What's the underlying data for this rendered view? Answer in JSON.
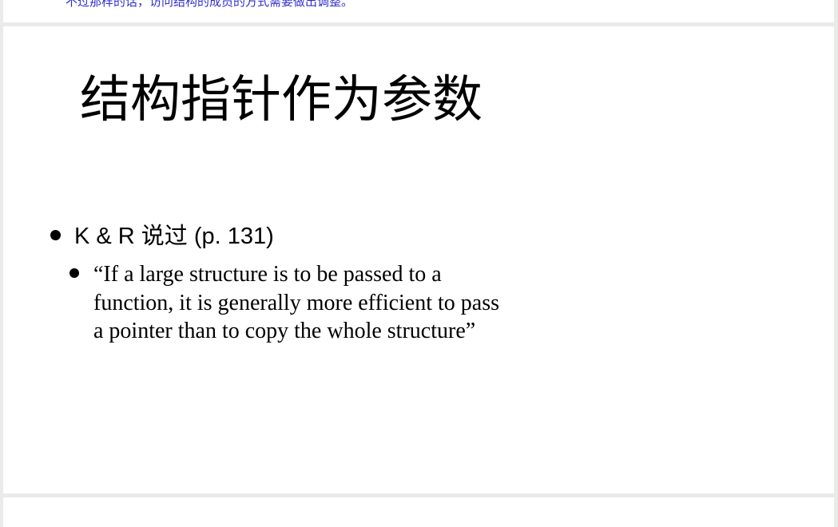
{
  "previous_page": {
    "note": "不过那样的话，访问结构的成员的方式需要做出调整。"
  },
  "slide": {
    "title": "结构指针作为参数",
    "bullets": [
      {
        "text": "K & R 说过 (p. 131)",
        "sub_bullets": [
          {
            "text": "“If a large structure is to be passed to a function, it is generally more efficient to pass a pointer than to copy the whole structure”"
          }
        ]
      }
    ]
  },
  "colors": {
    "viewer_background": "#e9ebe9",
    "page_background": "#ffffff",
    "note_text": "#2f2fd0",
    "body_text": "#000000"
  }
}
